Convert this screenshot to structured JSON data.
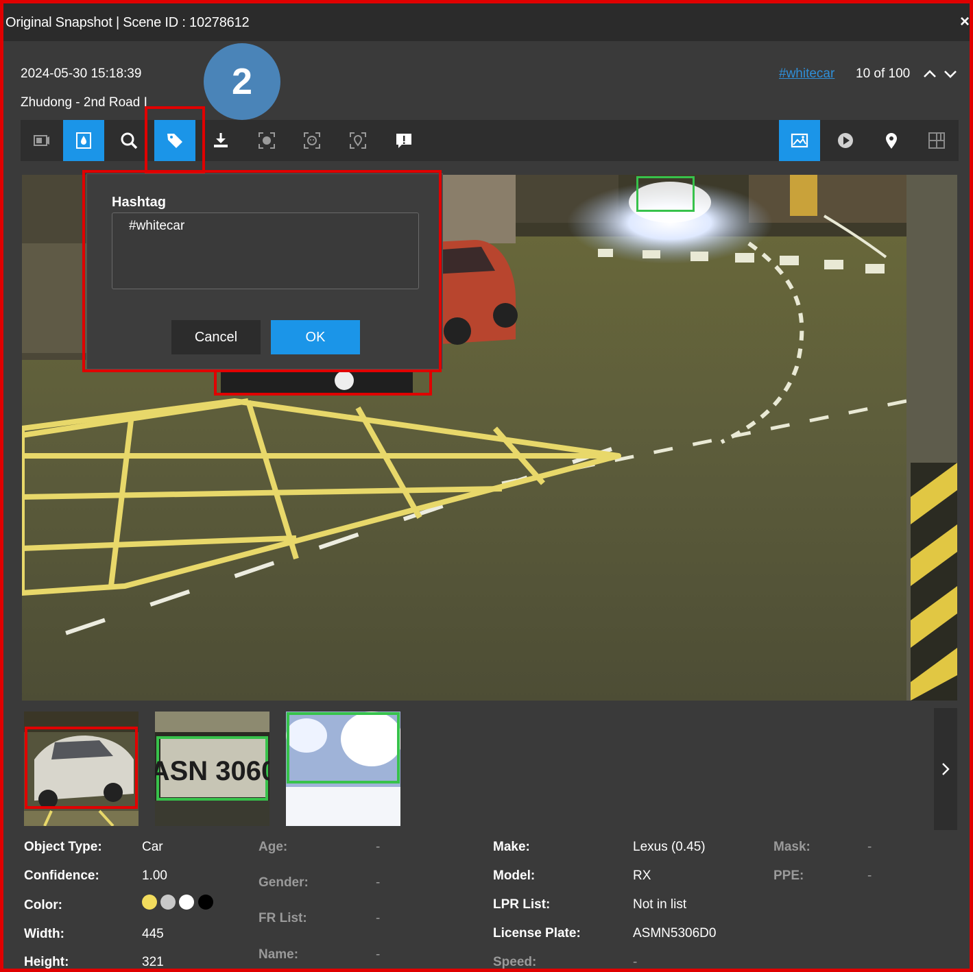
{
  "window": {
    "title": "Original Snapshot | Scene ID : 10278612",
    "close_icon": "×"
  },
  "event": {
    "datetime": "2024-05-30 15:18:39",
    "location": "Zhudong - 2nd Road I",
    "hashtag_link": "#whitecar",
    "counter": "10 of 100"
  },
  "step_badge": "2",
  "toolbar": {
    "left": [
      "camera-switch-icon",
      "watermark-icon",
      "search-icon",
      "tag-icon",
      "download-icon",
      "face-scan-icon",
      "face-detect-icon",
      "location-scan-icon",
      "report-icon"
    ],
    "right": [
      "image-view-icon",
      "play-icon",
      "map-pin-icon",
      "layout-icon"
    ],
    "active": [
      "watermark-icon",
      "tag-icon",
      "image-view-icon"
    ]
  },
  "dialog": {
    "label": "Hashtag",
    "value": "#whitecar",
    "cancel": "Cancel",
    "ok": "OK"
  },
  "thumbnails": [
    "car-thumbnail",
    "license-plate-thumbnail",
    "headlight-thumbnail"
  ],
  "plate_text": "ASN 3060",
  "details": {
    "object_type": {
      "label": "Object Type:",
      "value": "Car"
    },
    "confidence": {
      "label": "Confidence:",
      "value": "1.00"
    },
    "color": {
      "label": "Color:",
      "swatches": [
        "#f2dc5d",
        "#c9c9c9",
        "#ffffff",
        "#000000"
      ]
    },
    "width": {
      "label": "Width:",
      "value": "445"
    },
    "height": {
      "label": "Height:",
      "value": "321"
    },
    "age": {
      "label": "Age:",
      "value": "-"
    },
    "gender": {
      "label": "Gender:",
      "value": "-"
    },
    "fr_list": {
      "label": "FR List:",
      "value": "-"
    },
    "name": {
      "label": "Name:",
      "value": "-"
    },
    "make": {
      "label": "Make:",
      "value": "Lexus (0.45)"
    },
    "model": {
      "label": "Model:",
      "value": "RX"
    },
    "lpr_list": {
      "label": "LPR List:",
      "value": "Not in list"
    },
    "license_plate": {
      "label": "License Plate:",
      "value": "ASMN5306D0"
    },
    "speed": {
      "label": "Speed:",
      "value": "-"
    },
    "mask": {
      "label": "Mask:",
      "value": "-"
    },
    "ppe": {
      "label": "PPE:",
      "value": "-"
    }
  },
  "colors": {
    "accent": "#1b95e8",
    "highlight": "#e00000",
    "detection": "#37c24b",
    "badge": "#4a84b8"
  }
}
